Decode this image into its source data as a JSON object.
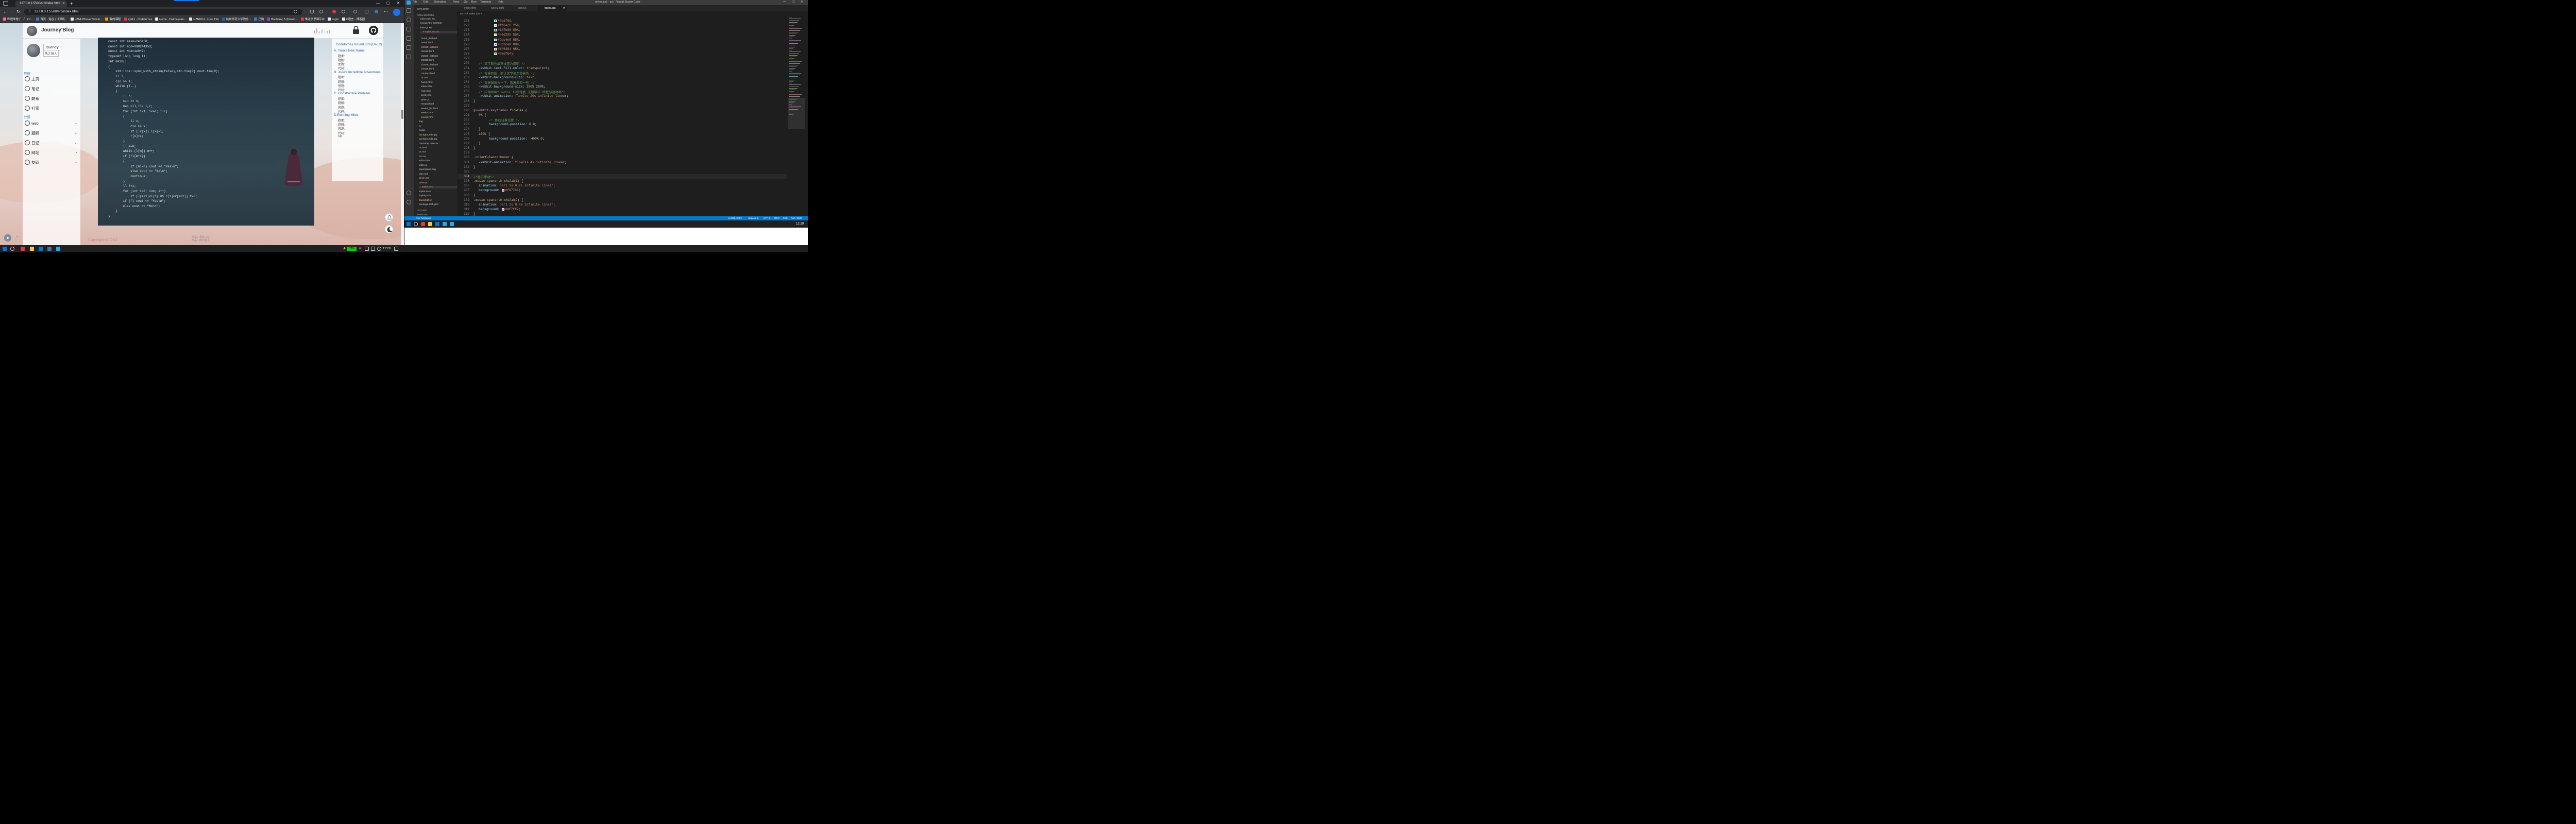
{
  "browser": {
    "tab_title": "127.0.0.1:5500/src/index.html",
    "url": "127.0.0.1:5500/src/index.html",
    "bookmarks": [
      {
        "label": "哔哩哔哩 (゜-゜)つ...",
        "color": "#fb7299"
      },
      {
        "label": "首页 - 洛谷 | 计算机...",
        "color": "#3b7ddd"
      },
      {
        "label": "HZNU21levelTrainin...",
        "color": "#e8eaed"
      },
      {
        "label": "我的课程",
        "color": "#ff9800"
      },
      {
        "label": "xyzkz - Codeforces",
        "color": "#e53935"
      },
      {
        "label": "Home - Daimayuan...",
        "color": "#e8eaed"
      },
      {
        "label": "HZNUOJ - User Info",
        "color": "#e8eaed"
      },
      {
        "label": "杭州师范大学教务...",
        "color": "#1565c0"
      },
      {
        "label": "已购",
        "color": "#1e88e5"
      },
      {
        "label": "Bootstrap 5 (forked...",
        "color": "#7952b3"
      },
      {
        "label": "惟洁学思课平台",
        "color": "#e53935"
      },
      {
        "label": "Login",
        "color": "#e8eaed"
      },
      {
        "label": "C语言 - 博客园",
        "color": "#e8eaed"
      }
    ]
  },
  "site": {
    "title": "Journey'Blog",
    "username": "Journey",
    "subtitle": "风之旅人",
    "nav_label": "导航",
    "nav_items": [
      "主页",
      "笔记",
      "联系",
      "打赏"
    ],
    "group_label": "分组",
    "group_items": [
      "web",
      "题解",
      "日记",
      "网站",
      "友链"
    ],
    "copyright": "Copyright © CKZ",
    "footer_lines": [
      "作品：框架 2.0",
      "作品：简约首页"
    ],
    "eq_colors": [
      "#f48fb1",
      "#ce93d8",
      "#a5d6a7",
      "#90caf9",
      "#fff59d",
      "#80cbc4",
      "#f48fb1"
    ],
    "code_lines": [
      "const int maxn=2e5+50;",
      "const int mod=998244353;",
      "const int Mod=1e9+7;",
      "typedef long long ll;",
      "int main()",
      "{",
      "    std::ios::sync_with_stdio(false),cin.tie(0),cout.tie(0);",
      "    ll T;",
      "    cin >> T;",
      "    while (T--)",
      "    {",
      "        ll n;",
      "        cin >> n;",
      "        map <ll,ll> l,r;",
      "        for (int i=1; i<=n; i++)",
      "        {",
      "            ll x;",
      "            cin >> x;",
      "            if (!r[x]) l[x]=i;",
      "            r[x]=i;",
      "        }",
      "        ll m=0;",
      "        while (l[m]) m++;",
      "        if (!l[m+1])",
      "        {",
      "            if (m!=n) cout << \"Yes\\n\";",
      "            else cout << \"No\\n\";",
      "            continue;",
      "        }",
      "        ll f=1;",
      "        for (int i=0; i<m; i++)",
      "            if (l[m+1]<l[i] && r[i]<r[m+1]) f=0;",
      "        if (f) cout << \"Yes\\n\";",
      "        else cout << \"No\\n\";",
      "    }",
      "}"
    ],
    "toc": {
      "title": "Codeforces Round 869 (Div. 2)",
      "sections": [
        {
          "title": "A. Yura's New Name",
          "items": [
            "题面:",
            "题解:",
            "思路:",
            "代码:"
          ]
        },
        {
          "title": "B. JoJo's Incredible Adventures",
          "items": [
            "题面:",
            "题解:",
            "思路:",
            "代码:"
          ]
        },
        {
          "title": "C. Constructive Problem",
          "items": [
            "题面:",
            "题解:",
            "思路:",
            "代码:"
          ]
        },
        {
          "title": "D.Running Miles",
          "items": [
            "题面:",
            "题解:",
            "思路:",
            "代码:",
            "top"
          ]
        }
      ]
    }
  },
  "vscode": {
    "window_title": "styles.css - src - Visual Studio Code",
    "menu": [
      "File",
      "Edit",
      "Selection",
      "View",
      "Go",
      "Run",
      "Terminal",
      "Help"
    ],
    "tabs": [
      "index.html",
      "week2.html",
      "index.js",
      "styles.css"
    ],
    "active_tab": "styles.css",
    "breadcrumb": "src > # styles.css > ...",
    "explorer_header": "EXPLORER",
    "open_editors_label": "OPEN EDITORS",
    "open_editors": [
      "index.html src",
      "week2.html src/html",
      "index.js src",
      "# styles.css src"
    ],
    "files": [
      "board_list.html",
      "board.html",
      "cf1818_list.html",
      "cf1818.html",
      "cf1820_list.html",
      "cf1820.html",
      "cf1826_list.html",
      "cf1826.html",
      "connect.html",
      "cs.css",
      "home.html",
      "index.html",
      "note.html",
      "prism.css",
      "prism.js",
      "reward.html",
      "week1_list.html",
      "week1.html",
      "week2.html",
      "img",
      "js",
      "music",
      "background3.jpg",
      "background2.jpg",
      "bootstrap.min.css",
      "cs.html",
      "cs.md",
      "cs1.txt",
      "index.html",
      "index.js",
      "paperplane.svg",
      "plan.md",
      "prism.css",
      "prism.js",
      "styles.css",
      "styles.scss",
      "stylesp.css",
      "stackEdit.txt",
      "package-lock.json"
    ],
    "outline_label": "OUTLINE",
    "timeline_label": "TIMELINE",
    "status_left": "Run Testcases",
    "status_right": [
      "Ln 304, Col 9",
      "Spaces: 2",
      "UTF-8",
      "CRLF",
      "CSS",
      "Port : 5500"
    ],
    "line_numbers": [
      "271",
      "272",
      "273",
      "274",
      "275",
      "276",
      "277",
      "278",
      "279",
      "280",
      "281",
      "282",
      "283",
      "284",
      "285",
      "286",
      "287",
      "288",
      "289",
      "290",
      "291",
      "292",
      "293",
      "294",
      "295",
      "296",
      "297",
      "298",
      "299",
      "300",
      "301",
      "302",
      "303",
      "304",
      "305",
      "306",
      "307",
      "308",
      "309",
      "310",
      "311",
      "312"
    ],
    "swatches": [
      "#0eaf6d",
      "#ff6ac6",
      "#147b96",
      "#e6d205",
      "#2cc4e0",
      "#8b2ce0",
      "#ff6384",
      "#08df64"
    ],
    "swatch_text": [
      "#0eaf6d,",
      "#ff6ac6 25%,",
      "#147b96 50%,",
      "#e6d205 55%,",
      "#2cc4e0 65%,",
      "#8b2ce0 80%,",
      "#ff6384 95%,",
      "#08df64);"
    ],
    "comments": {
      "c280": "/* 文字颜色填充设置为透明 */",
      "c282": "/* 背景剪裁，即让文字使用背景色 */",
      "c284": "/* 背景图放大一下，看着柔和一些 */",
      "c286": "/* 应用动画flowCss 12秒速度 无限循环 线性匀速动画*/",
      "c290": "/* 移动背景位置 */",
      "c304": "/*音乐律动*/"
    },
    "css": {
      "p281": "-webkit-text-fill-color",
      "v281": "transparent",
      "p283": "-webkit-background-clip",
      "v283": "text",
      "p285": "-webkit-background-size",
      "v285": "200% 200%",
      "p287": "-webkit-animation",
      "v287": "flowCss 20s infinite linear",
      "at289": "@-webkit-keyframes",
      "n289": "flowCss",
      "k290": "0%",
      "p291": "background-position",
      "v291": "0 0",
      "k293": "100%",
      "p294": "background-position",
      "v294": "-400% 0",
      "s299": ".colorfulword:hover",
      "p300": "-webkit-animation",
      "v300": "flowCss 4s infinite linear",
      "s305": ".music span:nth-child(1)",
      "p306": "animation",
      "v306": "bar1 2s 0.2s infinite linear",
      "p307": "background",
      "v307": "#f677b0",
      "s309": ".music span:nth-child(2)",
      "p310": "animation",
      "v310": "bar1 2s 0.4s infinite linear",
      "p311": "background",
      "v311": "#df7ff2"
    }
  },
  "taskbar": {
    "battery": "71%",
    "time_left": "12:29",
    "time_right": "12:29"
  }
}
